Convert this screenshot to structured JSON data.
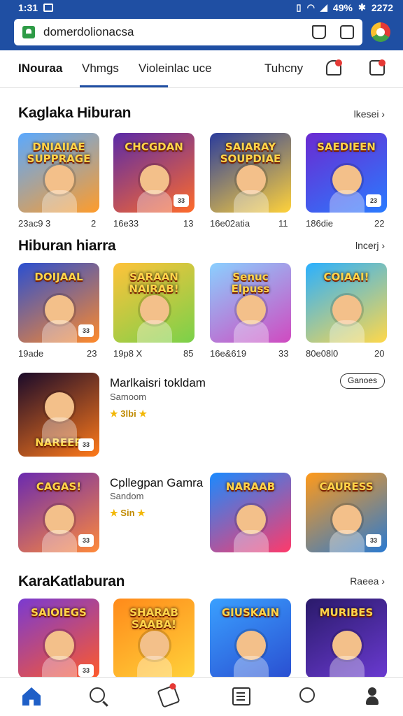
{
  "status_bar": {
    "time": "1:31",
    "battery": "49%",
    "right_text": "2272"
  },
  "browser": {
    "url": "domerdolionacsa"
  },
  "tabs": [
    {
      "label": "INouraa",
      "active": true
    },
    {
      "label": "Vhmgs",
      "active": false
    },
    {
      "label": "Violeinlac uce",
      "active": false
    },
    {
      "label": "Tuhcny",
      "active": false
    }
  ],
  "sections": [
    {
      "title": "Kaglaka Hiburan",
      "more": "lkesei ›",
      "tiles": [
        {
          "name": "DNIAIIAE SUPPRAGE",
          "left_meta": "23ac9 3",
          "right_meta": "2",
          "badge": "",
          "colors": [
            "#5aa9ff",
            "#ff9c2a"
          ]
        },
        {
          "name": "CHCGDAN",
          "left_meta": "16e33",
          "right_meta": "13",
          "badge": "33",
          "colors": [
            "#5a2aa8",
            "#ff6b2a"
          ]
        },
        {
          "name": "SAIARAY SOUPDIAE",
          "left_meta": "16e02atia",
          "right_meta": "11",
          "badge": "",
          "colors": [
            "#2a3c9c",
            "#ffd23a"
          ]
        },
        {
          "name": "SAEDIEEN",
          "left_meta": "186die",
          "right_meta": "22",
          "badge": "23",
          "colors": [
            "#6b2ad1",
            "#2a7bff"
          ]
        }
      ]
    },
    {
      "title": "Hiburan hiarra",
      "more": "lncerj ›",
      "tiles": [
        {
          "name": "DOIJAAL",
          "left_meta": "19ade",
          "right_meta": "23",
          "badge": "33",
          "colors": [
            "#2a4fd1",
            "#ff8a2a"
          ]
        },
        {
          "name": "SARAAN NAIRAB!",
          "left_meta": "19p8 X",
          "right_meta": "85",
          "badge": "",
          "colors": [
            "#ffc23a",
            "#7ad14a"
          ]
        },
        {
          "name": "Senuc Elpuss",
          "left_meta": "16e&619",
          "right_meta": "33",
          "badge": "",
          "colors": [
            "#8ad0ff",
            "#d04ac0"
          ]
        },
        {
          "name": "COIAAI!",
          "left_meta": "80e08l0",
          "right_meta": "20",
          "badge": "",
          "colors": [
            "#2ab0ff",
            "#ffd84a"
          ]
        }
      ]
    },
    {
      "title": "KaraKatlaburan",
      "more": "Raeea ›",
      "tiles": [
        {
          "name": "SAIOIEGS",
          "left_meta": "",
          "right_meta": "",
          "badge": "33",
          "colors": [
            "#7a3ad1",
            "#ff5a2a"
          ]
        },
        {
          "name": "SHARAB SAABA!",
          "left_meta": "",
          "right_meta": "",
          "badge": "",
          "colors": [
            "#ff8a1a",
            "#ffd23a"
          ]
        },
        {
          "name": "GIUSKAIN",
          "left_meta": "",
          "right_meta": "",
          "badge": "",
          "colors": [
            "#3aa0ff",
            "#2a4fd1"
          ]
        },
        {
          "name": "MURIBES",
          "left_meta": "",
          "right_meta": "",
          "badge": "",
          "colors": [
            "#2a1a6a",
            "#6a3ad1"
          ]
        }
      ]
    }
  ],
  "featured": [
    {
      "title": "Marlkaisri tokldam",
      "subtitle": "Samoom",
      "rating": "3lbi",
      "art_title": "NAREER",
      "badge": "33",
      "colors": [
        "#1a0a2a",
        "#ff7a1a"
      ],
      "action": "Ganoes"
    },
    {
      "title": "Cpllegpan Gamra",
      "subtitle": "Sandom",
      "rating": "Sin",
      "art_title": "CAGAS!",
      "badge": "33",
      "colors": [
        "#6a2ab0",
        "#ff8a3a"
      ],
      "action": ""
    }
  ],
  "featured_side_tiles": [
    {
      "name": "NARAAB",
      "badge": "",
      "colors": [
        "#1a8aff",
        "#ff3a6a"
      ]
    },
    {
      "name": "CAURESS",
      "badge": "33",
      "colors": [
        "#ff9a1a",
        "#2a7ad1"
      ]
    }
  ],
  "bottom_nav": [
    {
      "name": "home",
      "active": true
    },
    {
      "name": "search",
      "active": false
    },
    {
      "name": "notifications",
      "active": false
    },
    {
      "name": "feed",
      "active": false
    },
    {
      "name": "chat",
      "active": false
    },
    {
      "name": "profile",
      "active": false
    }
  ]
}
